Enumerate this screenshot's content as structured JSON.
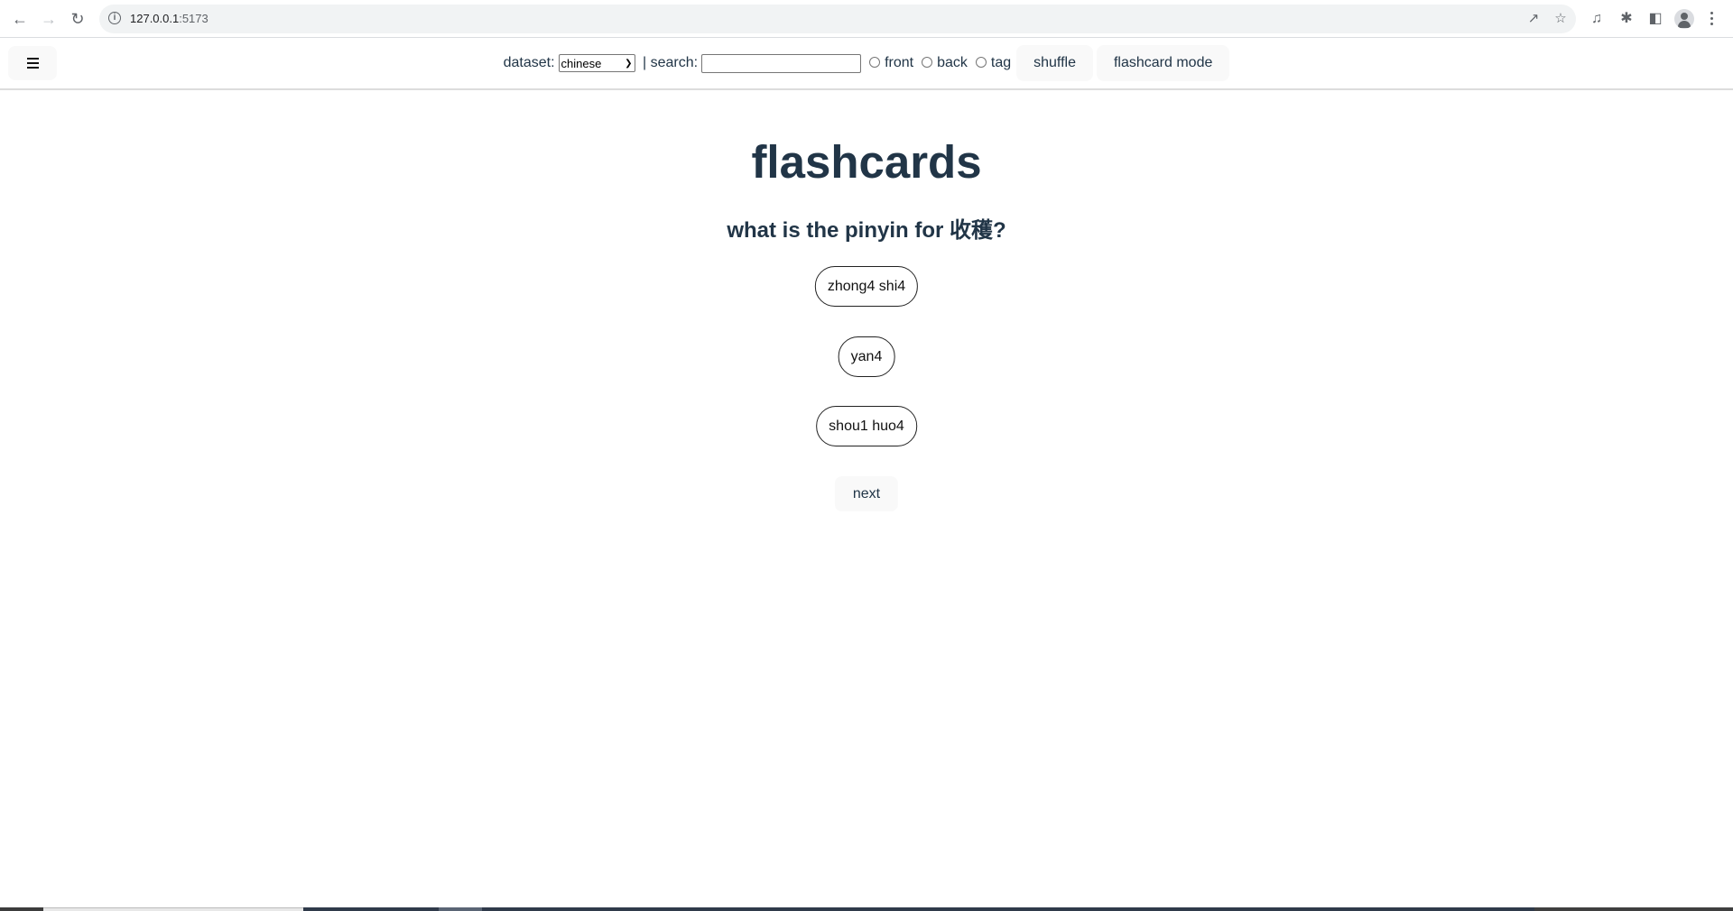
{
  "browser": {
    "url_host": "127.0.0.1",
    "url_port": ":5173",
    "icons": [
      "back-arrow-icon",
      "forward-arrow-icon",
      "reload-icon",
      "site-info-icon",
      "share-icon",
      "bookmark-star-icon",
      "extension-music-icon",
      "extensions-puzzle-icon",
      "side-panel-icon",
      "profile-avatar-icon",
      "more-menu-icon"
    ]
  },
  "header": {
    "menu_icon": "hamburger-icon",
    "dataset_label": "dataset:",
    "dataset_selected": "chinese",
    "separator_search_label": " | search:",
    "search_value": "",
    "search_placeholder": "",
    "radios": [
      {
        "label": "front",
        "checked": false
      },
      {
        "label": "back",
        "checked": false
      },
      {
        "label": "tag",
        "checked": false
      }
    ],
    "shuffle_label": "shuffle",
    "mode_label": "flashcard mode"
  },
  "main": {
    "title": "flashcards",
    "question": "what is the pinyin for 收穫?",
    "options": [
      "zhong4 shi4",
      "yan4",
      "shou1 huo4"
    ],
    "next_label": "next"
  },
  "colors": {
    "text_primary": "#213547",
    "button_bg": "#f9f9f9"
  }
}
